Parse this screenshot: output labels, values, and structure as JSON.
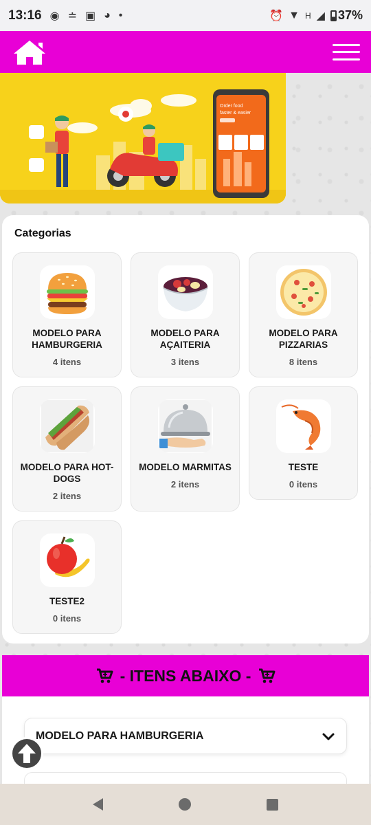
{
  "status_bar": {
    "time": "13:16",
    "notification_icons": [
      "chat-bubble-icon",
      "signal-alt-icon",
      "shopping-bag-icon",
      "bowl-icon",
      "dot-icon"
    ],
    "network_label": "H",
    "battery": "37%"
  },
  "header": {
    "home_icon": "home-icon",
    "menu_icon": "hamburger-menu-icon",
    "color": "#e800d6"
  },
  "banner": {
    "phone_text_line1": "Order food",
    "phone_text_line2": "faster & easier"
  },
  "categories": {
    "title": "Categorias",
    "items": [
      {
        "name": "MODELO PARA HAMBURGERIA",
        "count": "4 itens",
        "icon": "burger-icon"
      },
      {
        "name": "MODELO PARA AÇAITERIA",
        "count": "3 itens",
        "icon": "acai-bowl-icon"
      },
      {
        "name": "MODELO PARA PIZZARIAS",
        "count": "8 itens",
        "icon": "pizza-icon"
      },
      {
        "name": "MODELO PARA HOT-DOGS",
        "count": "2 itens",
        "icon": "hotdog-icon"
      },
      {
        "name": "MODELO MARMITAS",
        "count": "2 itens",
        "icon": "cloche-icon"
      },
      {
        "name": "TESTE",
        "count": "0 itens",
        "icon": "shrimp-icon"
      },
      {
        "name": "TESTE2",
        "count": "0 itens",
        "icon": "fruit-icon"
      }
    ]
  },
  "items_section": {
    "title": "- ITENS ABAIXO -",
    "accordion_label": "MODELO PARA HAMBURGERIA"
  }
}
